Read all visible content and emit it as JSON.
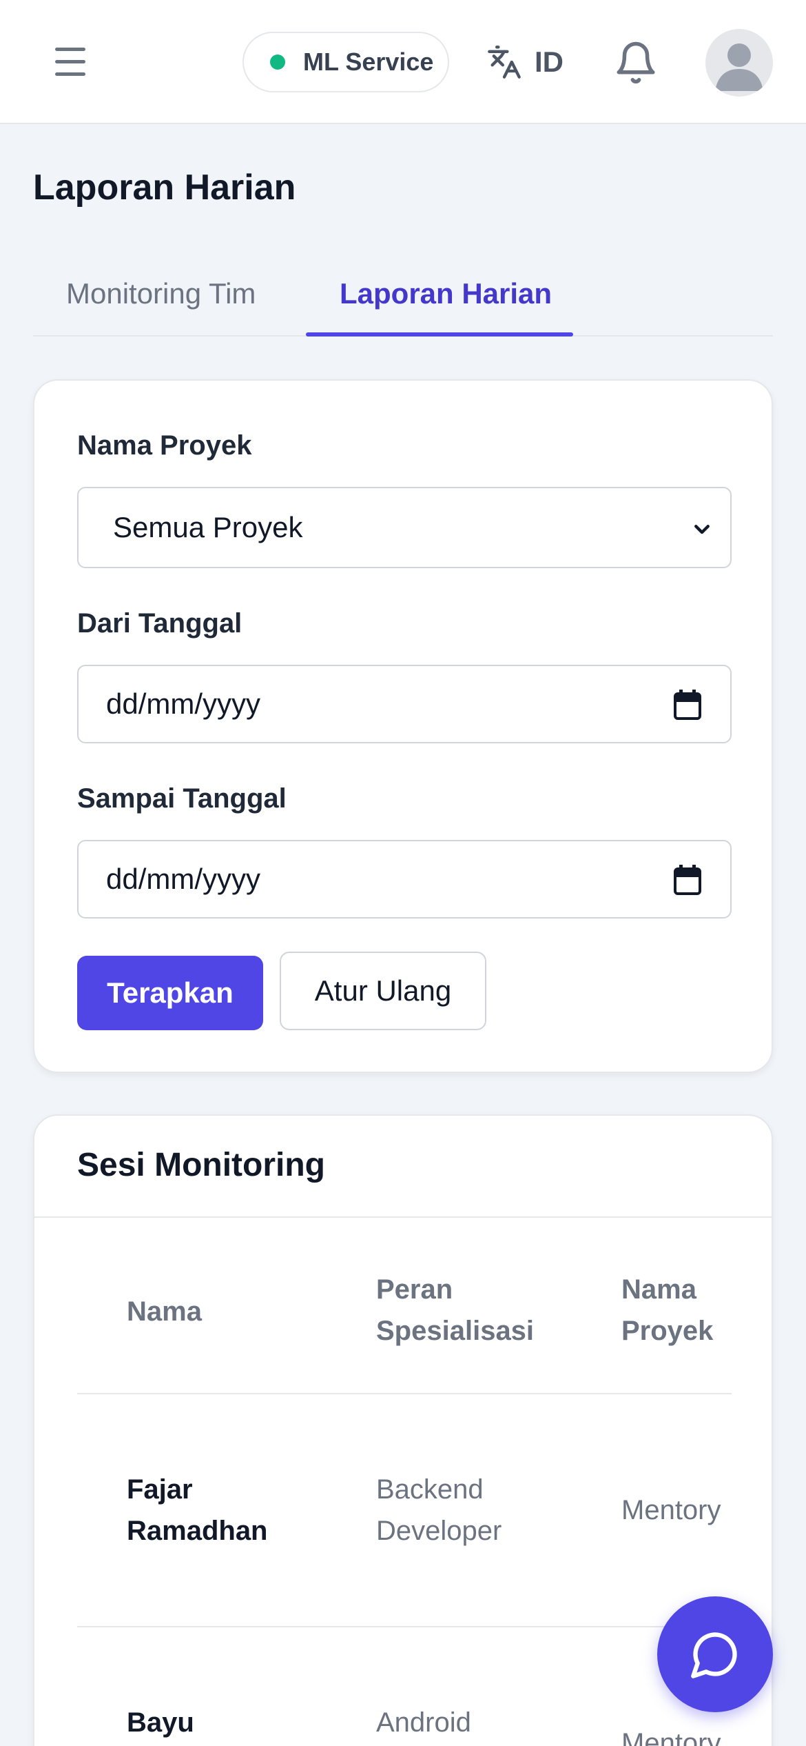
{
  "header": {
    "ml_service_label": "ML Service",
    "ml_service_status_color": "#10b981",
    "language_label": "ID",
    "icons": [
      "menu-icon",
      "translate-icon",
      "bell-icon",
      "user-avatar-icon"
    ]
  },
  "page": {
    "title": "Laporan Harian"
  },
  "tabs": [
    {
      "label": "Monitoring Tim",
      "active": false
    },
    {
      "label": "Laporan Harian",
      "active": true
    }
  ],
  "filters": {
    "project_label": "Nama Proyek",
    "project_selected": "Semua Proyek",
    "from_label": "Dari Tanggal",
    "from_placeholder": "dd/mm/yyyy",
    "to_label": "Sampai Tanggal",
    "to_placeholder": "dd/mm/yyyy",
    "apply_label": "Terapkan",
    "reset_label": "Atur Ulang"
  },
  "sessions": {
    "title": "Sesi Monitoring",
    "columns": {
      "name": "Nama",
      "role_line1": "Peran",
      "role_line2": "Spesialisasi",
      "project_line1": "Nama",
      "project_line2": "Proyek"
    },
    "rows": [
      {
        "name_line1": "Fajar",
        "name_line2": "Ramadhan",
        "role_line1": "Backend",
        "role_line2": "Developer",
        "project": "Mentory"
      },
      {
        "name_line1": "Bayu",
        "name_line2": "",
        "role_line1": "Android",
        "role_line2": "",
        "project": "Mentory"
      }
    ]
  },
  "colors": {
    "accent": "#4f46e5",
    "accent_text": "#4338ca",
    "background": "#f1f4f9"
  }
}
